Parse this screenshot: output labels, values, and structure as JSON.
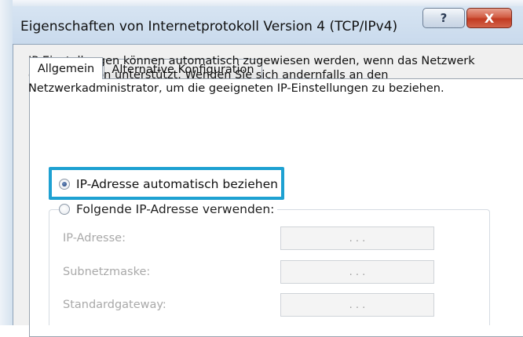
{
  "window": {
    "title": "Eigenschaften von Internetprotokoll Version 4 (TCP/IPv4)",
    "help_label": "?",
    "close_label": "X"
  },
  "tabs": [
    {
      "label": "Allgemein",
      "active": true
    },
    {
      "label": "Alternative Konfiguration",
      "active": false
    }
  ],
  "intro_text": "IP-Einstellungen können automatisch zugewiesen werden, wenn das Netzwerk diese Funktion unterstützt. Wenden Sie sich andernfalls an den Netzwerkadministrator, um die geeigneten IP-Einstellungen zu beziehen.",
  "options": {
    "auto_label": "IP-Adresse automatisch beziehen",
    "auto_selected": true,
    "manual_label": "Folgende IP-Adresse verwenden:",
    "manual_selected": false
  },
  "fields": [
    {
      "label": "IP-Adresse:",
      "value": ". . .",
      "enabled": false
    },
    {
      "label": "Subnetzmaske:",
      "value": ". . .",
      "enabled": false
    },
    {
      "label": "Standardgateway:",
      "value": ". . .",
      "enabled": false
    }
  ],
  "colors": {
    "highlight": "#1ea1d2",
    "close_button": "#c23b22"
  },
  "icons": {
    "help": "question-mark-icon",
    "close": "close-icon"
  }
}
